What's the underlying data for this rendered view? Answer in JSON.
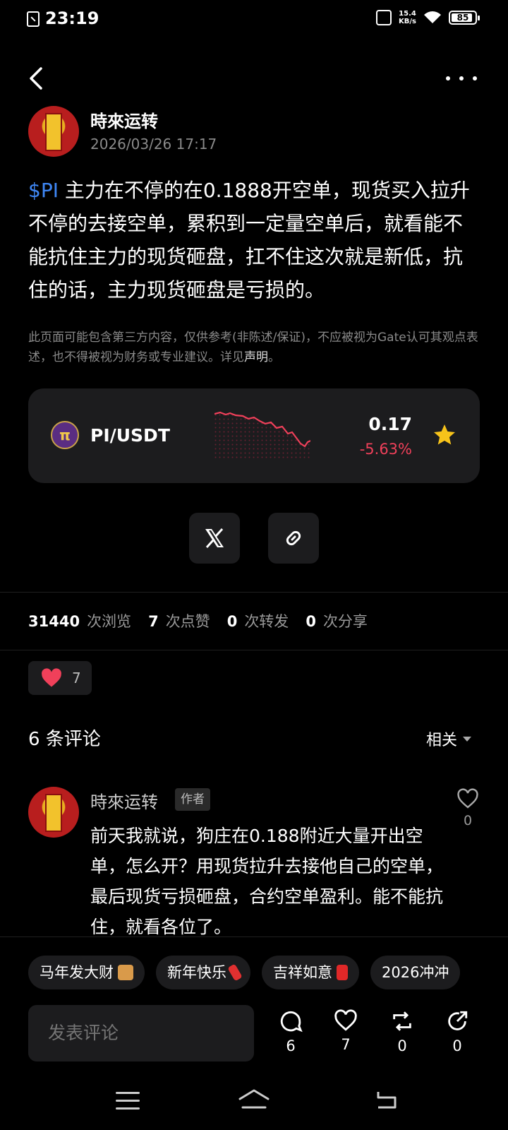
{
  "status": {
    "time": "23:19",
    "speed_top": "15.4",
    "speed_bottom": "KB/s",
    "battery": "85"
  },
  "post": {
    "author": "時來运转",
    "time": "2026/03/26 17:17",
    "ticker": "$PI",
    "body": " 主力在不停的在0.1888开空单，现货买入拉升不停的去接空单，累积到一定量空单后，就看能不能抗住主力的现货砸盘，扛不住这次就是新低，抗住的话，主力现货砸盘是亏损的。",
    "disclaimer": "此页面可能包含第三方内容，仅供参考(非陈述/保证)，不应被视为Gate认可其观点表述，也不得被视为财务或专业建议。详见",
    "disclaimer_link": "声明",
    "disclaimer_end": "。"
  },
  "market": {
    "pair": "PI/USDT",
    "logo": "π",
    "price": "0.17",
    "change": "-5.63%",
    "change_fraction": -0.0563
  },
  "stats": {
    "views": "31440",
    "views_label": "次浏览",
    "likes": "7",
    "likes_label": "次点赞",
    "reposts": "0",
    "reposts_label": "次转发",
    "shares": "0",
    "shares_label": "次分享"
  },
  "like_chip": {
    "count": "7"
  },
  "comments": {
    "title": "6 条评论",
    "sort": "相关",
    "items": [
      {
        "name": "時來运转",
        "badge": "作者",
        "text": "前天我就说，狗庄在0.188附近大量开出空单，怎么开？用现货拉升去接他自己的空单，最后现货亏损砸盘，合约空单盈利。能不能抗住，就看各位了。",
        "likes": "0"
      }
    ]
  },
  "chips": [
    {
      "label": "马年发大财"
    },
    {
      "label": "新年快乐"
    },
    {
      "label": "吉祥如意"
    },
    {
      "label": "2026冲冲"
    }
  ],
  "bottom": {
    "input_placeholder": "发表评论",
    "comments": "6",
    "likes": "7",
    "reposts": "0",
    "shares": "0"
  },
  "colors": {
    "accent_blue": "#3f87f5",
    "down_red": "#f0405a",
    "star": "#f7c31a",
    "heart": "#f0405a"
  }
}
